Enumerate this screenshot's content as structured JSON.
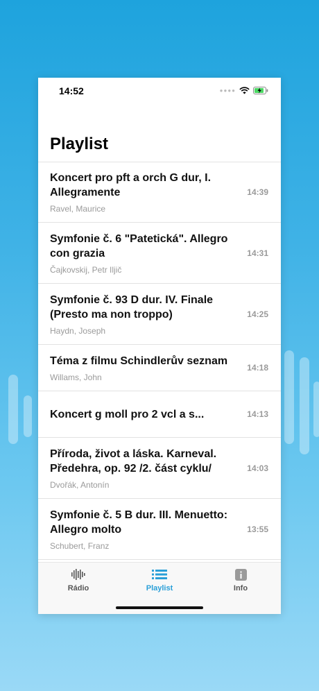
{
  "status_bar": {
    "time": "14:52",
    "icons": [
      "signal-dots-icon",
      "wifi-icon",
      "battery-charging-icon"
    ]
  },
  "page_title": "Playlist",
  "playlist": [
    {
      "title": "Koncert pro pft a orch G dur, I. Allegramente",
      "artist": "Ravel, Maurice",
      "time": "14:39"
    },
    {
      "title": "Symfonie č. 6 \"Patetická\". Allegro con grazia",
      "artist": "Čajkovskij, Petr Iljič",
      "time": "14:31"
    },
    {
      "title": "Symfonie č. 93 D dur. IV. Finale (Presto ma non troppo)",
      "artist": "Haydn, Joseph",
      "time": "14:25"
    },
    {
      "title": "Téma z filmu Schindlerův seznam",
      "artist": "Willams, John",
      "time": "14:18"
    },
    {
      "title": "Koncert g moll pro 2 vcl a s...",
      "artist": "",
      "time": "14:13"
    },
    {
      "title": "Příroda, život a láska. Karneval. Předehra, op. 92 /2. část cyklu/",
      "artist": "Dvořák, Antonín",
      "time": "14:03"
    },
    {
      "title": "Symfonie č. 5 B dur. III. Menuetto: Allegro molto",
      "artist": "Schubert, Franz",
      "time": "13:55"
    }
  ],
  "tabs": [
    {
      "label": "Rádio",
      "icon": "waveform-icon"
    },
    {
      "label": "Playlist",
      "icon": "list-icon",
      "active": true
    },
    {
      "label": "Info",
      "icon": "info-icon"
    }
  ],
  "colors": {
    "accent": "#2a9fd8",
    "inactive": "#555555",
    "background_top": "#1ea3dd",
    "background_bottom": "#9ad9f6"
  }
}
